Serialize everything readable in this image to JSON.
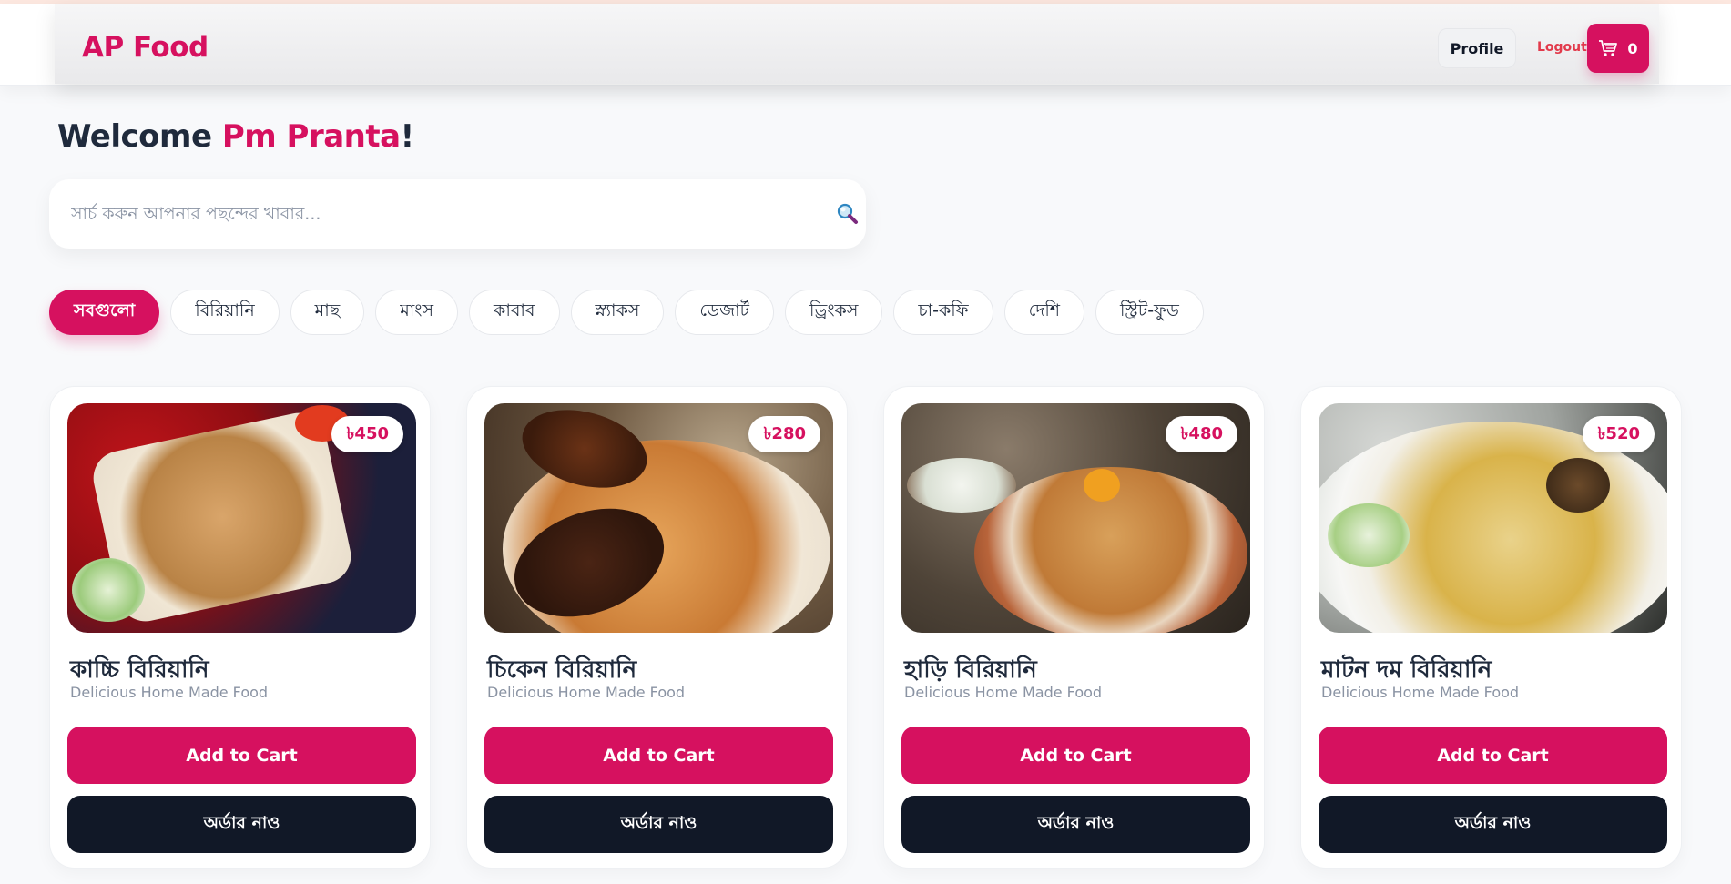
{
  "brand": {
    "name": "AP Food",
    "accent": "#d6115f",
    "dark": "#111827"
  },
  "nav": {
    "profile_label": "Profile",
    "logout_label": "Logout",
    "cart_count": "0",
    "cart_icon": "cart-icon"
  },
  "welcome": {
    "prefix": "Welcome ",
    "user": "Pm Pranta",
    "suffix": "!"
  },
  "search": {
    "placeholder": "সার্চ করুন আপনার পছন্দের খাবার...",
    "value": "",
    "icon": "search-icon"
  },
  "categories": [
    {
      "label": "সবগুলো",
      "active": true
    },
    {
      "label": "বিরিয়ানি"
    },
    {
      "label": "মাছ"
    },
    {
      "label": "মাংস"
    },
    {
      "label": "কাবাব"
    },
    {
      "label": "স্ন্যাকস"
    },
    {
      "label": "ডেজার্ট"
    },
    {
      "label": "ড্রিংকস"
    },
    {
      "label": "চা-কফি"
    },
    {
      "label": "দেশি"
    },
    {
      "label": "স্ট্রিট-ফুড"
    }
  ],
  "products": [
    {
      "title": "কাচ্চি বিরিয়ানি",
      "subtitle": "Delicious Home Made Food",
      "price": "৳450",
      "add_label": "Add to Cart",
      "order_label": "অর্ডার নাও"
    },
    {
      "title": "চিকেন বিরিয়ানি",
      "subtitle": "Delicious Home Made Food",
      "price": "৳280",
      "add_label": "Add to Cart",
      "order_label": "অর্ডার নাও"
    },
    {
      "title": "হাড়ি বিরিয়ানি",
      "subtitle": "Delicious Home Made Food",
      "price": "৳480",
      "add_label": "Add to Cart",
      "order_label": "অর্ডার নাও"
    },
    {
      "title": "মাটন দম বিরিয়ানি",
      "subtitle": "Delicious Home Made Food",
      "price": "৳520",
      "add_label": "Add to Cart",
      "order_label": "অর্ডার নাও"
    }
  ]
}
